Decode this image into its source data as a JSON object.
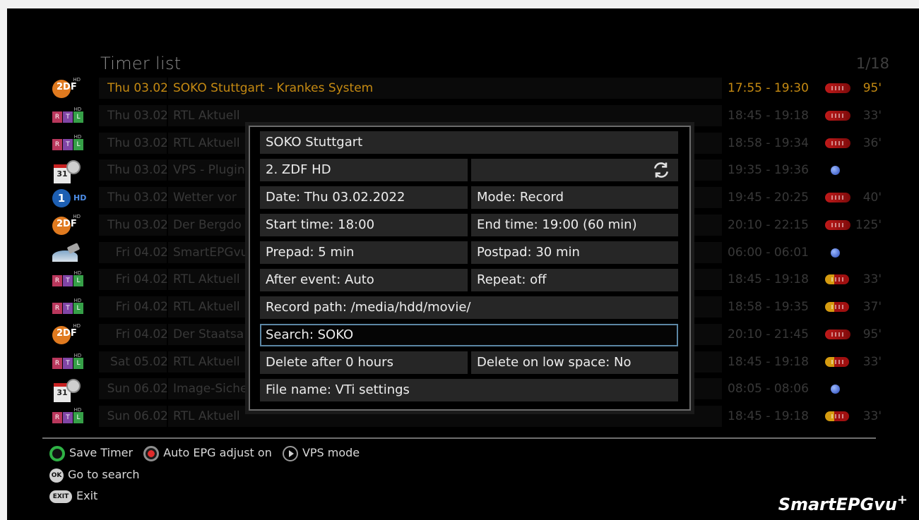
{
  "header": {
    "title": "Timer list",
    "page": "1/18"
  },
  "rows": [
    {
      "channel": "ZDF HD",
      "logo": "zdf",
      "date": "Thu 03.02",
      "title": "SOKO Stuttgart - Krankes System",
      "time": "17:55 - 19:30",
      "rec": "red",
      "dur": "95'",
      "active": true
    },
    {
      "channel": "RTL HD",
      "logo": "rtl",
      "date": "Thu 03.02",
      "title": "RTL Aktuell",
      "time": "18:45 - 19:18",
      "rec": "red",
      "dur": "33'"
    },
    {
      "channel": "RTL HD",
      "logo": "rtl",
      "date": "Thu 03.02",
      "title": "RTL Aktuell",
      "time": "18:58 - 19:34",
      "rec": "red",
      "dur": "36'"
    },
    {
      "channel": "Calendar",
      "logo": "cal",
      "date": "Thu 03.02",
      "title": "VPS - Plugin",
      "time": "19:35 - 19:36",
      "rec": "vps",
      "dur": ""
    },
    {
      "channel": "Das Erste HD",
      "logo": "ard",
      "date": "Thu 03.02",
      "title": "Wetter vor",
      "time": "19:45 - 20:25",
      "rec": "red",
      "dur": "40'"
    },
    {
      "channel": "ZDF HD",
      "logo": "zdf",
      "date": "Thu 03.02",
      "title": "Der Bergdo",
      "time": "20:10 - 22:15",
      "rec": "red",
      "dur": "125'"
    },
    {
      "channel": "Satellite",
      "logo": "sat",
      "date": "Fri 04.02",
      "title": "SmartEPGvu",
      "time": "06:00 - 06:01",
      "rec": "vps",
      "dur": ""
    },
    {
      "channel": "RTL HD",
      "logo": "rtl",
      "date": "Fri 04.02",
      "title": "RTL Aktuell",
      "time": "18:45 - 19:18",
      "rec": "auto",
      "dur": "33'"
    },
    {
      "channel": "RTL HD",
      "logo": "rtl",
      "date": "Fri 04.02",
      "title": "RTL Aktuell",
      "time": "18:58 - 19:35",
      "rec": "auto",
      "dur": "37'"
    },
    {
      "channel": "ZDF HD",
      "logo": "zdf",
      "date": "Fri 04.02",
      "title": "Der Staatsa",
      "time": "20:10 - 21:45",
      "rec": "red",
      "dur": "95'"
    },
    {
      "channel": "RTL HD",
      "logo": "rtl",
      "date": "Sat 05.02",
      "title": "RTL Aktuell",
      "time": "18:45 - 19:18",
      "rec": "auto",
      "dur": "33'"
    },
    {
      "channel": "Calendar",
      "logo": "cal",
      "date": "Sun 06.02",
      "title": "Image-Siche",
      "time": "08:05 - 08:06",
      "rec": "vps",
      "dur": ""
    },
    {
      "channel": "RTL HD",
      "logo": "rtl",
      "date": "Sun 06.02",
      "title": "RTL Aktuell",
      "time": "18:45 - 19:18",
      "rec": "auto",
      "dur": "33'"
    }
  ],
  "dialog": {
    "name": "SOKO Stuttgart",
    "service": "2. ZDF HD",
    "date": "Date: Thu 03.02.2022",
    "mode": "Mode: Record",
    "start": "Start time: 18:00",
    "end": "End time: 19:00 (60 min)",
    "prepad": "Prepad: 5 min",
    "postpad": "Postpad: 30 min",
    "after_event": "After event: Auto",
    "repeat": "Repeat: off",
    "record_path": "Record path: /media/hdd/movie/",
    "search": "Search: SOKO",
    "delete_after": "Delete after 0 hours",
    "delete_low": "Delete on low space: No",
    "file_name": "File name: VTi settings"
  },
  "legend": {
    "save": "Save Timer",
    "auto_epg": "Auto EPG adjust on",
    "vps": "VPS mode",
    "ok_key": "OK",
    "go_search": "Go to search",
    "exit_key": "EXIT",
    "exit": "Exit"
  },
  "brand": {
    "name": "SmartEPGvu",
    "sup": "+"
  },
  "colors": {
    "active_text": "#c58a12",
    "dim_text": "#383838",
    "accent_border": "#5b86a4",
    "green_key": "#2fb245",
    "red_key": "#e02b2b"
  }
}
